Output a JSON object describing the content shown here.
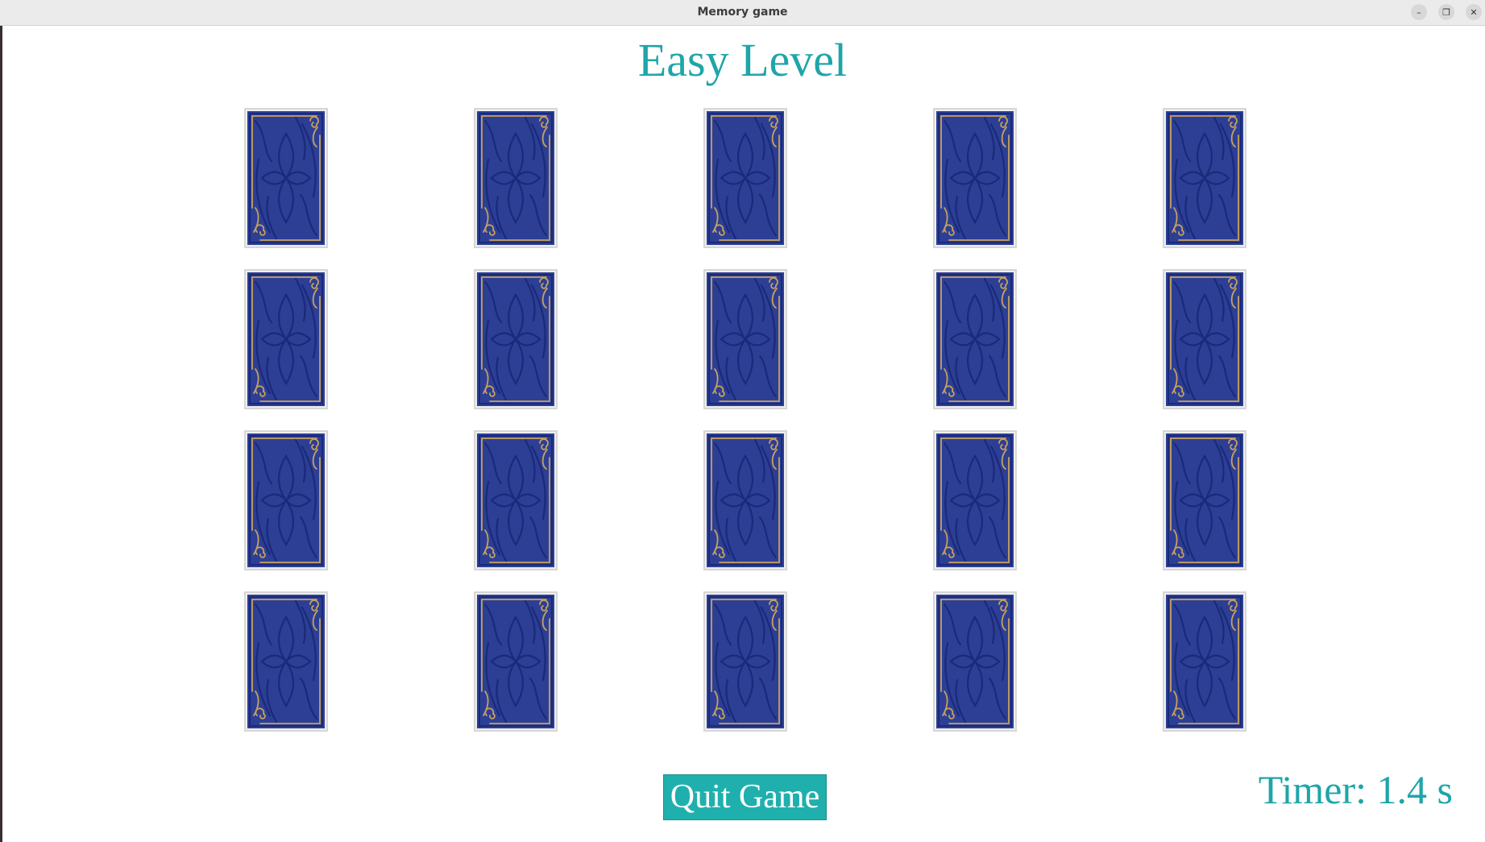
{
  "window": {
    "title": "Memory game",
    "minimize_glyph": "–",
    "maximize_glyph": "❐",
    "close_glyph": "✕"
  },
  "game": {
    "level_title": "Easy Level",
    "grid": {
      "rows": 4,
      "columns": 5
    },
    "cards": [
      {
        "state": "face-down"
      },
      {
        "state": "face-down"
      },
      {
        "state": "face-down"
      },
      {
        "state": "face-down"
      },
      {
        "state": "face-down"
      },
      {
        "state": "face-down"
      },
      {
        "state": "face-down"
      },
      {
        "state": "face-down"
      },
      {
        "state": "face-down"
      },
      {
        "state": "face-down"
      },
      {
        "state": "face-down"
      },
      {
        "state": "face-down"
      },
      {
        "state": "face-down"
      },
      {
        "state": "face-down"
      },
      {
        "state": "face-down"
      },
      {
        "state": "face-down"
      },
      {
        "state": "face-down"
      },
      {
        "state": "face-down"
      },
      {
        "state": "face-down"
      },
      {
        "state": "face-down"
      }
    ],
    "quit_label": "Quit Game",
    "timer_text": "Timer: 1.4 s"
  },
  "colors": {
    "accent": "#1fa5a9",
    "button": "#1fb0ad",
    "card_back": "#2c3f95",
    "card_pattern": "#1a2a7a",
    "card_trim": "#c9a05c"
  }
}
